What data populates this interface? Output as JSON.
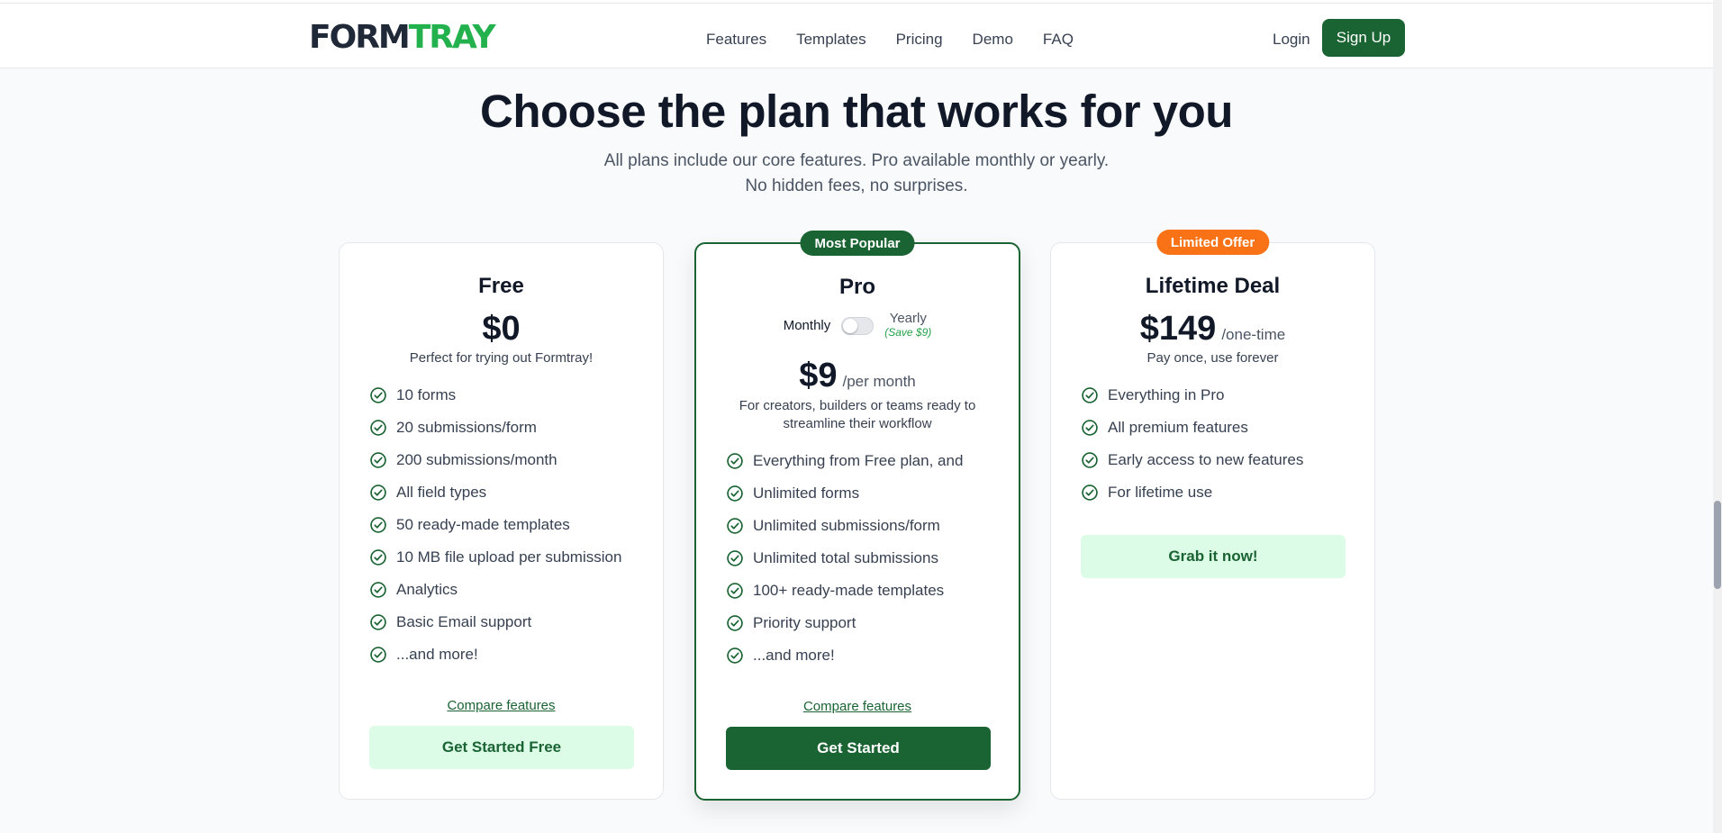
{
  "nav": {
    "logo_part1": "FORM",
    "logo_part2": "TRAY",
    "links": [
      "Features",
      "Templates",
      "Pricing",
      "Demo",
      "FAQ"
    ],
    "login": "Login",
    "signup": "Sign Up"
  },
  "hero": {
    "title": "Choose the plan that works for you",
    "subtitle_line1": "All plans include our core features. Pro available monthly or yearly.",
    "subtitle_line2": "No hidden fees, no surprises."
  },
  "plans": {
    "free": {
      "name": "Free",
      "price": "$0",
      "description": "Perfect for trying out Formtray!",
      "features": [
        "10 forms",
        "20 submissions/form",
        "200 submissions/month",
        "All field types",
        "50 ready-made templates",
        "10 MB file upload per submission",
        "Analytics",
        "Basic Email support",
        "...and more!"
      ],
      "compare": "Compare features",
      "cta": "Get Started Free"
    },
    "pro": {
      "badge": "Most Popular",
      "name": "Pro",
      "toggle_monthly": "Monthly",
      "toggle_yearly": "Yearly",
      "toggle_save": "(Save $9)",
      "price": "$9",
      "period": "/per month",
      "description": "For creators, builders or teams ready to streamline their workflow",
      "features": [
        "Everything from Free plan, and",
        "Unlimited forms",
        "Unlimited submissions/form",
        "Unlimited total submissions",
        "100+ ready-made templates",
        "Priority support",
        "...and more!"
      ],
      "compare": "Compare features",
      "cta": "Get Started"
    },
    "lifetime": {
      "badge": "Limited Offer",
      "name": "Lifetime Deal",
      "price": "$149",
      "period": "/one-time",
      "description": "Pay once, use forever",
      "features": [
        "Everything in Pro",
        "All premium features",
        "Early access to new features",
        "For lifetime use"
      ],
      "cta": "Grab it now!"
    }
  },
  "colors": {
    "brand_green": "#1a6332",
    "logo_green": "#22b14c",
    "offer_orange": "#f97316",
    "light_green": "#dcfce7"
  }
}
